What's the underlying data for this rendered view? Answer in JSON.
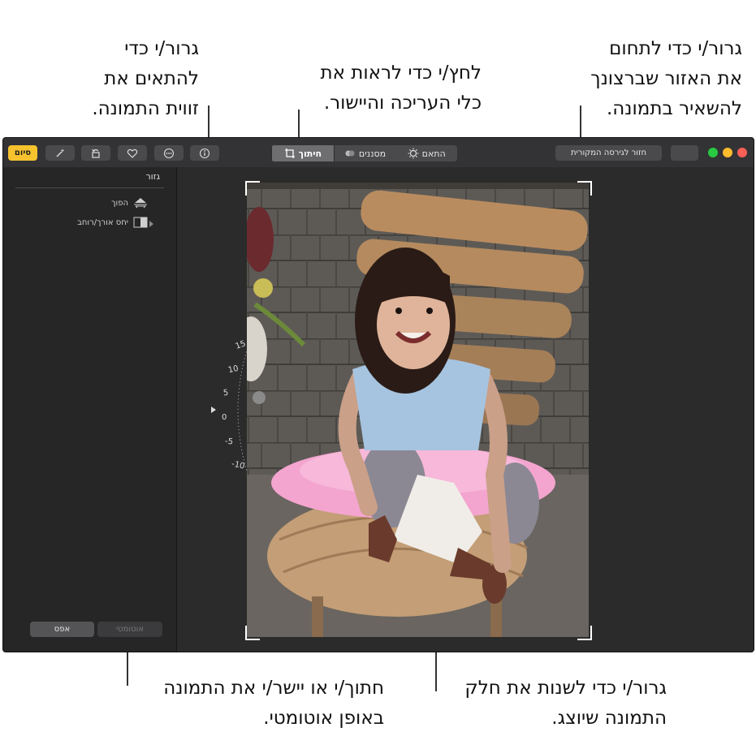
{
  "callouts": {
    "top_left": [
      "גרור/י כדי",
      "להתאים את",
      "זווית התמונה."
    ],
    "top_center": [
      "לחץ/י כדי לראות את",
      "כלי העריכה והיישור."
    ],
    "top_right": [
      "גרור/י כדי לתחום",
      "את האזור שברצונך",
      "להשאיר בתמונה."
    ],
    "bottom_left": [
      "חתוך/י או יישר/י את התמונה",
      "באופן אוטומטי."
    ],
    "bottom_right": [
      "גרור/י כדי לשנות את חלק",
      "התמונה שיוצג."
    ]
  },
  "toolbar": {
    "done_label": "סיום",
    "tabs": [
      {
        "label": "התאם",
        "icon": "adjust-icon"
      },
      {
        "label": "מסננים",
        "icon": "filters-icon"
      },
      {
        "label": "חיתוך",
        "icon": "crop-icon",
        "active": true
      }
    ],
    "revert_label": "חזור לגירסה המקורית",
    "icons": [
      "magic-wand-icon",
      "rotate-icon",
      "heart-icon",
      "more-icon",
      "info-icon"
    ]
  },
  "sidebar": {
    "title": "גזור",
    "items": [
      {
        "label": "הפוך",
        "icon": "flip-icon"
      },
      {
        "label": "יחס אורך/רוחב",
        "icon": "aspect-icon"
      }
    ],
    "auto_label": "אוטומטי",
    "reset_label": "אפס"
  },
  "dial": {
    "ticks": [
      "15",
      "10",
      "5",
      "0",
      "-5",
      "-10"
    ],
    "value": 0
  },
  "colors": {
    "accent": "#f6c32e",
    "traffic_red": "#fe5f57",
    "traffic_yellow": "#febc2e",
    "traffic_green": "#28c840"
  }
}
